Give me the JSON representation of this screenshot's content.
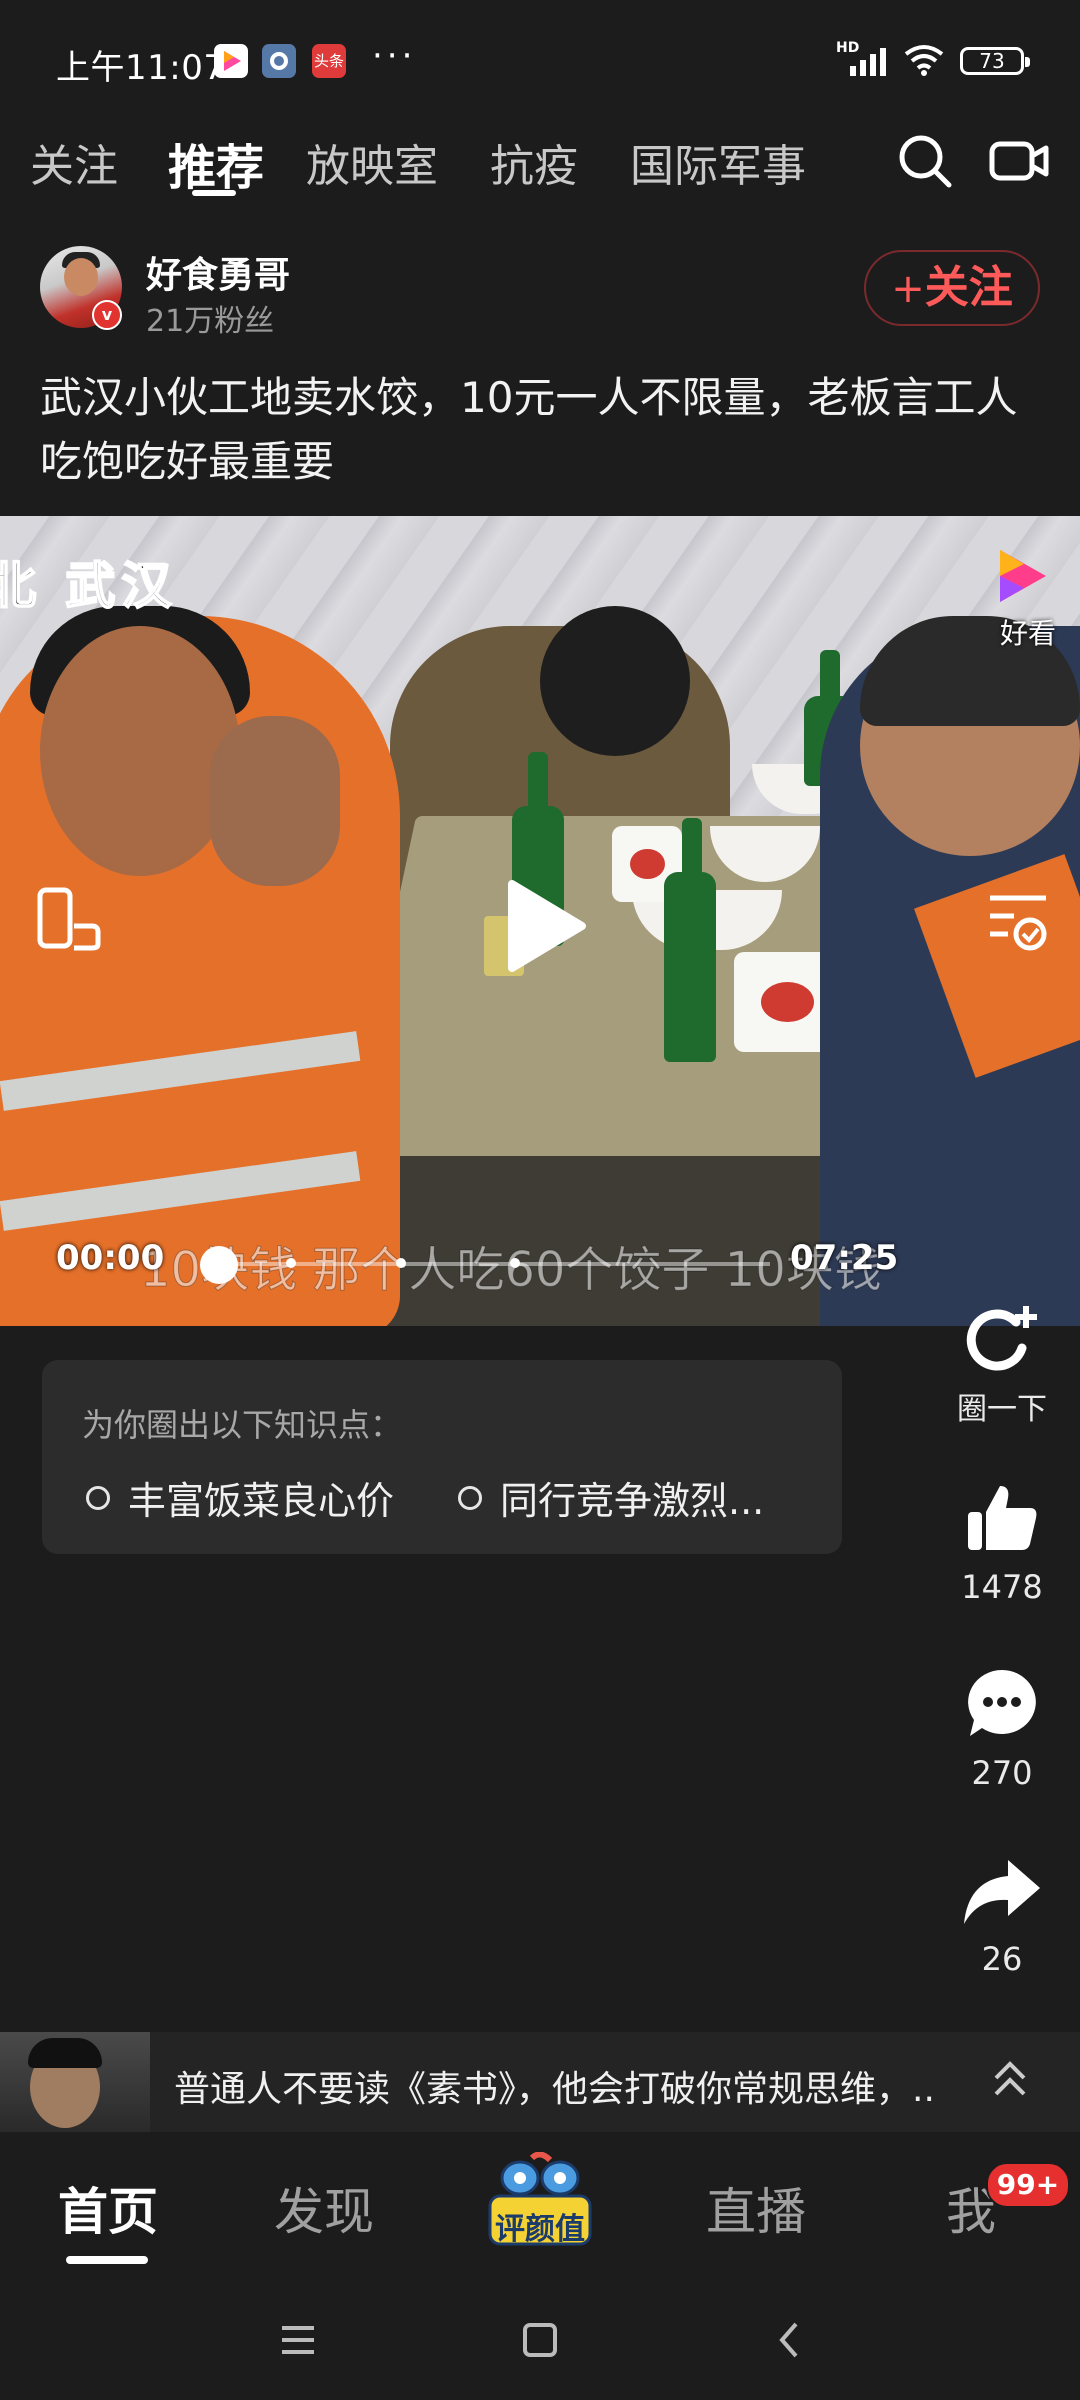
{
  "status_bar": {
    "time": "上午11:07",
    "app_icons": [
      "video-app-icon",
      "settings-icon",
      "toutiao-icon"
    ],
    "toutiao_label": "头条",
    "more": "···",
    "network": "HD",
    "battery": "73"
  },
  "top_tabs": {
    "items": [
      {
        "label": "关注",
        "active": false
      },
      {
        "label": "推荐",
        "active": true
      },
      {
        "label": "放映室",
        "active": false
      },
      {
        "label": "抗疫",
        "active": false
      },
      {
        "label": "国际军事",
        "active": false
      }
    ],
    "icons": [
      "search-icon",
      "camera-icon"
    ]
  },
  "author": {
    "name": "好食勇哥",
    "fans": "21万粉丝",
    "follow_label": "关注",
    "follow_plus": "+"
  },
  "video": {
    "title": "武汉小伙工地卖水饺，10元一人不限量，老板言工人吃饱吃好最重要",
    "city_caption": "北 武汉",
    "logo_text": "好看",
    "current_time": "00:00",
    "duration": "07:25",
    "subtitle": "10块钱  那个人吃60个饺子  10块钱",
    "progress": 0.0
  },
  "knowledge": {
    "title": "为你圈出以下知识点：",
    "points": [
      "丰富饭菜良心价",
      "同行竞争激烈..."
    ]
  },
  "actions": [
    {
      "icon": "circle-add-icon",
      "label": "圈一下"
    },
    {
      "icon": "thumbs-up-icon",
      "label": "1478"
    },
    {
      "icon": "comment-icon",
      "label": "270"
    },
    {
      "icon": "share-icon",
      "label": "26"
    }
  ],
  "related": {
    "text": "普通人不要读《素书》，他会打破你常规思维，..."
  },
  "bottom_nav": {
    "items": [
      {
        "label": "首页",
        "active": true
      },
      {
        "label": "发现",
        "active": false
      },
      {
        "label": "评颜值",
        "active": false
      },
      {
        "label": "直播",
        "active": false
      },
      {
        "label": "我",
        "active": false
      }
    ],
    "badge": "99+"
  },
  "colors": {
    "background": "#1c1c1c",
    "accent_red": "#ff5a5a",
    "badge_red": "#e62f2f",
    "card": "#2c2c2c"
  }
}
